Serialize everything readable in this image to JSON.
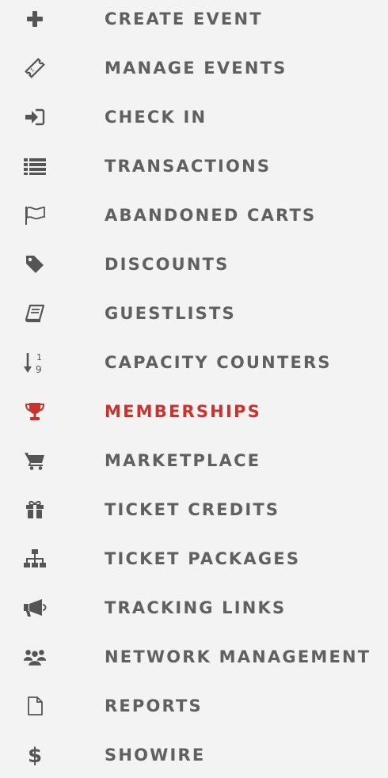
{
  "nav": {
    "active_color": "#c9332e",
    "text_color": "#606060",
    "icon_color": "#555555",
    "items": [
      {
        "label": "CREATE EVENT",
        "icon": "plus-icon"
      },
      {
        "label": "MANAGE EVENTS",
        "icon": "ticket-icon"
      },
      {
        "label": "CHECK IN",
        "icon": "sign-in-icon"
      },
      {
        "label": "TRANSACTIONS",
        "icon": "list-icon"
      },
      {
        "label": "ABANDONED CARTS",
        "icon": "flag-icon"
      },
      {
        "label": "DISCOUNTS",
        "icon": "tag-icon"
      },
      {
        "label": "GUESTLISTS",
        "icon": "book-icon"
      },
      {
        "label": "CAPACITY COUNTERS",
        "icon": "sort-numeric-icon"
      },
      {
        "label": "MEMBERSHIPS",
        "icon": "trophy-icon",
        "active": true
      },
      {
        "label": "MARKETPLACE",
        "icon": "shopping-cart-icon"
      },
      {
        "label": "TICKET CREDITS",
        "icon": "gift-icon"
      },
      {
        "label": "TICKET PACKAGES",
        "icon": "sitemap-icon"
      },
      {
        "label": "TRACKING LINKS",
        "icon": "bullhorn-icon"
      },
      {
        "label": "NETWORK MANAGEMENT",
        "icon": "users-icon"
      },
      {
        "label": "REPORTS",
        "icon": "file-icon"
      },
      {
        "label": "SHOWIRE",
        "icon": "dollar-icon"
      }
    ]
  }
}
